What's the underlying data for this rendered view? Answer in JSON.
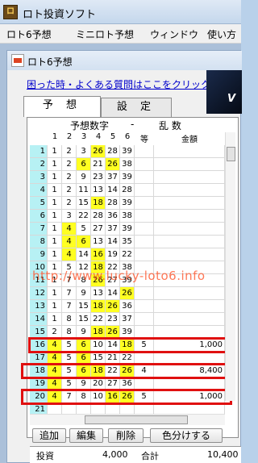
{
  "window": {
    "title": "ロト投資ソフト",
    "icon": "app-logo-icon"
  },
  "menu": [
    "ロト6予想",
    "ミニロト予想",
    "ウィンドウ",
    "使い方"
  ],
  "child": {
    "title": "ロト6予想",
    "help_link": "困った時・よくある質問はここをクリック",
    "banner_text": "V"
  },
  "tabs": [
    "予 想",
    "設 定"
  ],
  "grid": {
    "header_left": "予想数字",
    "header_dash": "-",
    "header_right": "乱 数",
    "columns": [
      "1",
      "2",
      "3",
      "4",
      "5",
      "6",
      "等",
      "金額"
    ],
    "rows": [
      {
        "n": "1",
        "v": [
          "1",
          "2",
          "3",
          "26",
          "28",
          "39"
        ],
        "h": [
          false,
          false,
          false,
          true,
          false,
          false
        ],
        "rank": "",
        "amount": ""
      },
      {
        "n": "2",
        "v": [
          "1",
          "2",
          "6",
          "21",
          "26",
          "38"
        ],
        "h": [
          false,
          false,
          true,
          false,
          true,
          false
        ],
        "rank": "",
        "amount": ""
      },
      {
        "n": "3",
        "v": [
          "1",
          "2",
          "9",
          "23",
          "37",
          "39"
        ],
        "h": [
          false,
          false,
          false,
          false,
          false,
          false
        ],
        "rank": "",
        "amount": ""
      },
      {
        "n": "4",
        "v": [
          "1",
          "2",
          "11",
          "13",
          "14",
          "28"
        ],
        "h": [
          false,
          false,
          false,
          false,
          false,
          false
        ],
        "rank": "",
        "amount": ""
      },
      {
        "n": "5",
        "v": [
          "1",
          "2",
          "15",
          "18",
          "28",
          "39"
        ],
        "h": [
          false,
          false,
          false,
          true,
          false,
          false
        ],
        "rank": "",
        "amount": ""
      },
      {
        "n": "6",
        "v": [
          "1",
          "3",
          "22",
          "28",
          "36",
          "38"
        ],
        "h": [
          false,
          false,
          false,
          false,
          false,
          false
        ],
        "rank": "",
        "amount": ""
      },
      {
        "n": "7",
        "v": [
          "1",
          "4",
          "5",
          "27",
          "37",
          "39"
        ],
        "h": [
          false,
          true,
          false,
          false,
          false,
          false
        ],
        "rank": "",
        "amount": ""
      },
      {
        "n": "8",
        "v": [
          "1",
          "4",
          "6",
          "13",
          "14",
          "35"
        ],
        "h": [
          false,
          true,
          true,
          false,
          false,
          false
        ],
        "rank": "",
        "amount": ""
      },
      {
        "n": "9",
        "v": [
          "1",
          "4",
          "14",
          "16",
          "19",
          "22"
        ],
        "h": [
          false,
          true,
          false,
          true,
          false,
          false
        ],
        "rank": "",
        "amount": ""
      },
      {
        "n": "10",
        "v": [
          "1",
          "5",
          "12",
          "18",
          "22",
          "38"
        ],
        "h": [
          false,
          false,
          false,
          true,
          false,
          false
        ],
        "rank": "",
        "amount": ""
      },
      {
        "n": "11",
        "v": [
          "1",
          "7",
          "8",
          "26",
          "27",
          "39"
        ],
        "h": [
          false,
          false,
          false,
          true,
          false,
          false
        ],
        "rank": "",
        "amount": ""
      },
      {
        "n": "12",
        "v": [
          "1",
          "7",
          "9",
          "13",
          "14",
          "26"
        ],
        "h": [
          false,
          false,
          false,
          false,
          false,
          true
        ],
        "rank": "",
        "amount": ""
      },
      {
        "n": "13",
        "v": [
          "1",
          "7",
          "15",
          "18",
          "26",
          "36"
        ],
        "h": [
          false,
          false,
          false,
          true,
          true,
          false
        ],
        "rank": "",
        "amount": ""
      },
      {
        "n": "14",
        "v": [
          "1",
          "8",
          "15",
          "22",
          "23",
          "37"
        ],
        "h": [
          false,
          false,
          false,
          false,
          false,
          false
        ],
        "rank": "",
        "amount": ""
      },
      {
        "n": "15",
        "v": [
          "2",
          "8",
          "9",
          "18",
          "26",
          "39"
        ],
        "h": [
          false,
          false,
          false,
          true,
          true,
          false
        ],
        "rank": "",
        "amount": ""
      },
      {
        "n": "16",
        "v": [
          "4",
          "5",
          "6",
          "10",
          "14",
          "18"
        ],
        "h": [
          true,
          false,
          true,
          false,
          false,
          true
        ],
        "rank": "5",
        "amount": "1,000"
      },
      {
        "n": "17",
        "v": [
          "4",
          "5",
          "6",
          "15",
          "21",
          "22"
        ],
        "h": [
          true,
          false,
          true,
          false,
          false,
          false
        ],
        "rank": "",
        "amount": ""
      },
      {
        "n": "18",
        "v": [
          "4",
          "5",
          "6",
          "18",
          "22",
          "26"
        ],
        "h": [
          true,
          false,
          true,
          true,
          false,
          true
        ],
        "rank": "4",
        "amount": "8,400"
      },
      {
        "n": "19",
        "v": [
          "4",
          "5",
          "9",
          "20",
          "27",
          "36"
        ],
        "h": [
          true,
          false,
          false,
          false,
          false,
          false
        ],
        "rank": "",
        "amount": ""
      },
      {
        "n": "20",
        "v": [
          "4",
          "7",
          "8",
          "10",
          "16",
          "26"
        ],
        "h": [
          true,
          false,
          false,
          false,
          true,
          true
        ],
        "rank": "5",
        "amount": "1,000"
      },
      {
        "n": "21",
        "v": [
          "",
          "",
          "",
          "",
          "",
          ""
        ],
        "h": [
          false,
          false,
          false,
          false,
          false,
          false
        ],
        "rank": "",
        "amount": ""
      }
    ]
  },
  "watermark": "http://www.lucky-loto6.info",
  "buttons": [
    "追加",
    "編集",
    "削除",
    "色分けする"
  ],
  "summary": {
    "invest_label": "投資",
    "invest_value": "4,000",
    "total_label": "合計",
    "total_value": "10,400"
  },
  "colors": {
    "number_col": "#b7f1f4",
    "hit": "#ffff22",
    "highlight_box": "#e01010",
    "link": "#0000cc"
  }
}
